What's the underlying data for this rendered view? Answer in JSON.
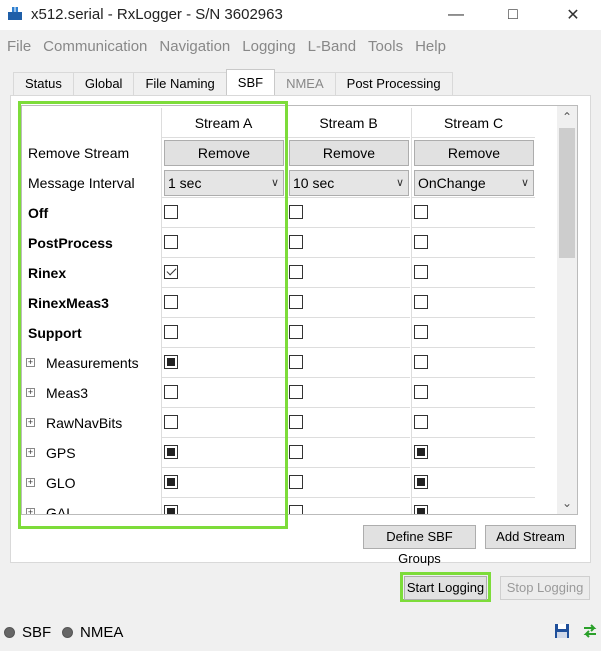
{
  "window": {
    "title": "x512.serial - RxLogger - S/N 3602963",
    "controls": [
      "minimize",
      "maximize",
      "close"
    ]
  },
  "menu": [
    "File",
    "Communication",
    "Navigation",
    "Logging",
    "L-Band",
    "Tools",
    "Help"
  ],
  "tabs": [
    {
      "label": "Status",
      "state": "normal"
    },
    {
      "label": "Global",
      "state": "normal"
    },
    {
      "label": "File Naming",
      "state": "normal"
    },
    {
      "label": "SBF",
      "state": "active"
    },
    {
      "label": "NMEA",
      "state": "disabled"
    },
    {
      "label": "Post Processing",
      "state": "normal"
    }
  ],
  "grid": {
    "streams": [
      "Stream A",
      "Stream B",
      "Stream C"
    ],
    "remove_label": "Remove Stream",
    "remove_button": "Remove",
    "interval_label": "Message Interval",
    "intervals": [
      "1 sec",
      "10 sec",
      "OnChange"
    ],
    "rows": [
      {
        "label": "Off",
        "bold": true,
        "expander": false,
        "values": [
          "unchecked",
          "unchecked",
          "unchecked"
        ]
      },
      {
        "label": "PostProcess",
        "bold": true,
        "expander": false,
        "values": [
          "unchecked",
          "unchecked",
          "unchecked"
        ]
      },
      {
        "label": "Rinex",
        "bold": true,
        "expander": false,
        "values": [
          "checked",
          "unchecked",
          "unchecked"
        ]
      },
      {
        "label": "RinexMeas3",
        "bold": true,
        "expander": false,
        "values": [
          "unchecked",
          "unchecked",
          "unchecked"
        ]
      },
      {
        "label": "Support",
        "bold": true,
        "expander": false,
        "values": [
          "unchecked",
          "unchecked",
          "unchecked"
        ]
      },
      {
        "label": "Measurements",
        "bold": false,
        "expander": true,
        "values": [
          "partial",
          "unchecked",
          "unchecked"
        ]
      },
      {
        "label": "Meas3",
        "bold": false,
        "expander": true,
        "values": [
          "unchecked",
          "unchecked",
          "unchecked"
        ]
      },
      {
        "label": "RawNavBits",
        "bold": false,
        "expander": true,
        "values": [
          "unchecked",
          "unchecked",
          "unchecked"
        ]
      },
      {
        "label": "GPS",
        "bold": false,
        "expander": true,
        "values": [
          "partial",
          "unchecked",
          "partial"
        ]
      },
      {
        "label": "GLO",
        "bold": false,
        "expander": true,
        "values": [
          "partial",
          "unchecked",
          "partial"
        ]
      },
      {
        "label": "GAL",
        "bold": false,
        "expander": true,
        "values": [
          "partial",
          "unchecked",
          "partial"
        ]
      }
    ]
  },
  "buttons": {
    "define_groups": "Define SBF Groups",
    "add_stream": "Add Stream",
    "start_logging": "Start Logging",
    "stop_logging": "Stop Logging"
  },
  "status": {
    "items": [
      "SBF",
      "NMEA"
    ]
  },
  "colors": {
    "highlight": "#7ddc3a"
  }
}
